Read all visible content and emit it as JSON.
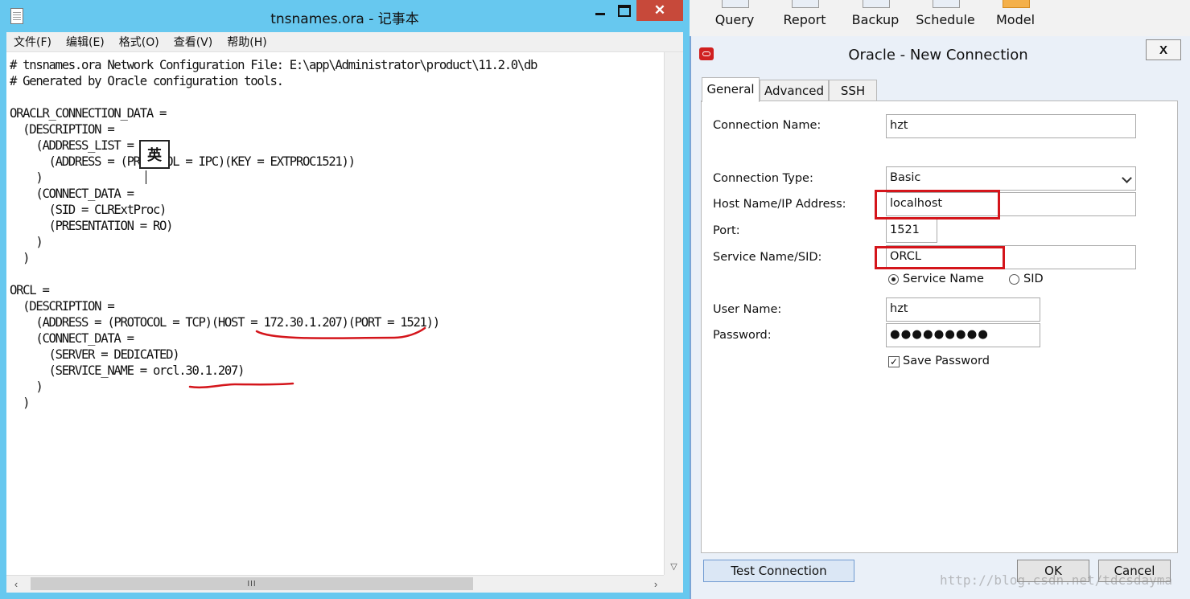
{
  "notepad": {
    "title": "tnsnames.ora - 记事本",
    "close_glyph": "✕",
    "menu": [
      "文件(F)",
      "编辑(E)",
      "格式(O)",
      "查看(V)",
      "帮助(H)"
    ],
    "content": "# tnsnames.ora Network Configuration File: E:\\app\\Administrator\\product\\11.2.0\\db\n# Generated by Oracle configuration tools.\n\nORACLR_CONNECTION_DATA =\n  (DESCRIPTION =\n    (ADDRESS_LIST =\n      (ADDRESS = (PROTOCOL = IPC)(KEY = EXTPROC1521))\n    )\n    (CONNECT_DATA =\n      (SID = CLRExtProc)\n      (PRESENTATION = RO)\n    )\n  )\n\nORCL =\n  (DESCRIPTION =\n    (ADDRESS = (PROTOCOL = TCP)(HOST = 172.30.1.207)(PORT = 1521))\n    (CONNECT_DATA =\n      (SERVER = DEDICATED)\n      (SERVICE_NAME = orcl.30.1.207)\n    )\n  )",
    "ime_label": "英",
    "scroll_grip": "III"
  },
  "toolbar": {
    "items": [
      "Query",
      "Report",
      "Backup",
      "Schedule",
      "Model"
    ]
  },
  "dialog": {
    "title": "Oracle - New Connection",
    "close_glyph": "X",
    "tabs": [
      "General",
      "Advanced",
      "SSH"
    ],
    "active_tab": "General",
    "fields": {
      "connection_name_label": "Connection Name:",
      "connection_name_value": "hzt",
      "connection_type_label": "Connection Type:",
      "connection_type_value": "Basic",
      "host_label": "Host Name/IP Address:",
      "host_value": "localhost",
      "port_label": "Port:",
      "port_value": "1521",
      "service_label": "Service Name/SID:",
      "service_value": "ORCL",
      "radio_service_name": "Service Name",
      "radio_sid": "SID",
      "username_label": "User Name:",
      "username_value": "hzt",
      "password_label": "Password:",
      "password_value": "●●●●●●●●●",
      "save_password_label": "Save Password",
      "save_password_checked": true
    },
    "buttons": {
      "test": "Test Connection",
      "ok": "OK",
      "cancel": "Cancel"
    }
  },
  "watermark": "http://blog.csdn.net/tdcsdayma",
  "annotation_color": "#d4151b"
}
